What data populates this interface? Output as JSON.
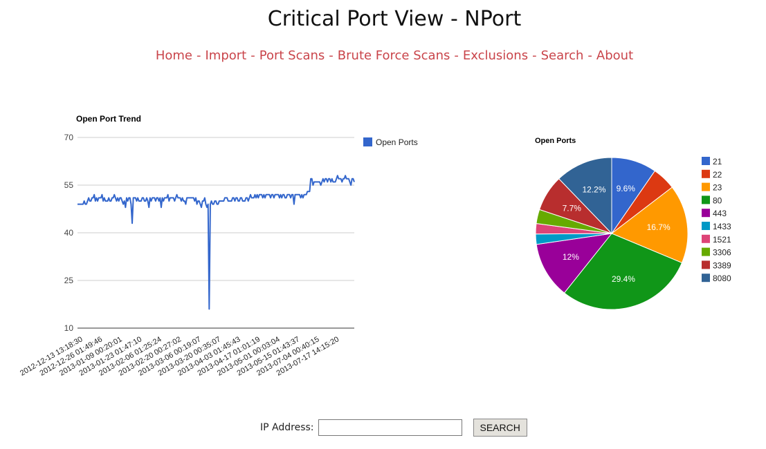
{
  "header": {
    "title": "Critical Port View - NPort"
  },
  "nav": {
    "items": [
      "Home",
      "Import",
      "Port Scans",
      "Brute Force Scans",
      "Exclusions",
      "Search",
      "About"
    ],
    "separator": "-"
  },
  "colors": {
    "nav_link": "#c9444a",
    "line_series": "#3366cc"
  },
  "search": {
    "label": "IP Address:",
    "placeholder": "",
    "value": "",
    "button_label": "SEARCH"
  },
  "chart_data": [
    {
      "type": "line",
      "title": "Open Port Trend",
      "ylim": [
        10,
        70
      ],
      "yticks": [
        10,
        25,
        40,
        55,
        70
      ],
      "grid": true,
      "legend_position": "right",
      "series": [
        {
          "name": "Open Ports",
          "color": "#3366cc",
          "values": [
            49,
            49,
            49,
            49,
            49,
            49,
            50,
            49,
            49,
            50,
            51,
            50,
            50,
            51,
            51,
            52,
            50,
            51,
            50,
            51,
            51,
            51,
            52,
            50,
            51,
            50,
            50,
            50,
            51,
            50,
            50,
            51,
            51,
            52,
            51,
            50,
            51,
            50,
            51,
            51,
            50,
            49,
            50,
            48,
            51,
            50,
            51,
            51,
            49,
            43,
            51,
            51,
            51,
            50,
            51,
            50,
            50,
            50,
            51,
            51,
            50,
            50,
            51,
            50,
            48,
            51,
            50,
            51,
            51,
            51,
            50,
            51,
            51,
            50,
            51,
            48,
            51,
            50,
            51,
            51,
            51,
            52,
            50,
            51,
            51,
            51,
            51,
            50,
            51,
            52,
            51,
            51,
            51,
            50,
            51,
            50,
            50,
            49,
            51,
            51,
            51,
            51,
            51,
            51,
            51,
            50,
            51,
            49,
            50,
            50,
            49,
            48,
            50,
            50,
            51,
            49,
            48,
            49,
            16,
            49,
            50,
            49,
            49,
            50,
            50,
            49,
            49,
            50,
            50,
            50,
            50,
            50,
            51,
            51,
            51,
            50,
            50,
            50,
            50,
            51,
            51,
            50,
            51,
            51,
            50,
            50,
            51,
            51,
            50,
            50,
            50,
            51,
            51,
            50,
            51,
            52,
            51,
            51,
            51,
            52,
            51,
            52,
            51,
            52,
            52,
            52,
            51,
            52,
            51,
            52,
            52,
            52,
            52,
            51,
            52,
            52,
            51,
            52,
            52,
            52,
            52,
            51,
            52,
            51,
            52,
            52,
            51,
            51,
            52,
            52,
            52,
            51,
            52,
            52,
            49,
            52,
            52,
            52,
            52,
            52,
            51,
            52,
            51,
            52,
            52,
            52,
            53,
            53,
            53,
            57,
            57,
            55,
            56,
            56,
            56,
            56,
            56,
            56,
            55,
            56,
            57,
            56,
            57,
            57,
            56,
            57,
            57,
            56,
            57,
            56,
            56,
            56,
            57,
            58,
            57,
            57,
            57,
            56,
            57,
            57,
            58,
            57,
            57,
            57,
            56,
            55,
            57,
            57,
            56
          ]
        }
      ],
      "x_tick_labels": [
        "2012-12-13 13:18:30",
        "2012-12-26 01:49:46",
        "2013-01-09 00:20:01",
        "2013-01-23 01:47:10",
        "2013-02-06 01:25:24",
        "2013-02-20 00:27:02",
        "2013-03-06 00:19:07",
        "2013-03-20 00:35:07",
        "2013-04-03 01:45:43",
        "2013-04-17 01:01:19",
        "2013-05-01 00:03:04",
        "2013-05-15 01:43:37",
        "2013-07-04 00:40:15",
        "2013-07-17 14:15:20"
      ]
    },
    {
      "type": "pie",
      "title": "Open Ports",
      "legend_position": "right",
      "slices": [
        {
          "label": "21",
          "value": 9.6,
          "pct_label": "9.6%",
          "color": "#3366cc"
        },
        {
          "label": "22",
          "value": 5.0,
          "pct_label": "",
          "color": "#dc3912"
        },
        {
          "label": "23",
          "value": 16.7,
          "pct_label": "16.7%",
          "color": "#ff9900"
        },
        {
          "label": "80",
          "value": 29.4,
          "pct_label": "29.4%",
          "color": "#109618"
        },
        {
          "label": "443",
          "value": 12.0,
          "pct_label": "12%",
          "color": "#990099"
        },
        {
          "label": "1433",
          "value": 2.2,
          "pct_label": "",
          "color": "#0099c6"
        },
        {
          "label": "1521",
          "value": 2.2,
          "pct_label": "",
          "color": "#dd4477"
        },
        {
          "label": "3306",
          "value": 3.0,
          "pct_label": "",
          "color": "#66aa00"
        },
        {
          "label": "3389",
          "value": 7.7,
          "pct_label": "7.7%",
          "color": "#b82e2e"
        },
        {
          "label": "8080",
          "value": 12.2,
          "pct_label": "12.2%",
          "color": "#316395"
        }
      ]
    }
  ]
}
